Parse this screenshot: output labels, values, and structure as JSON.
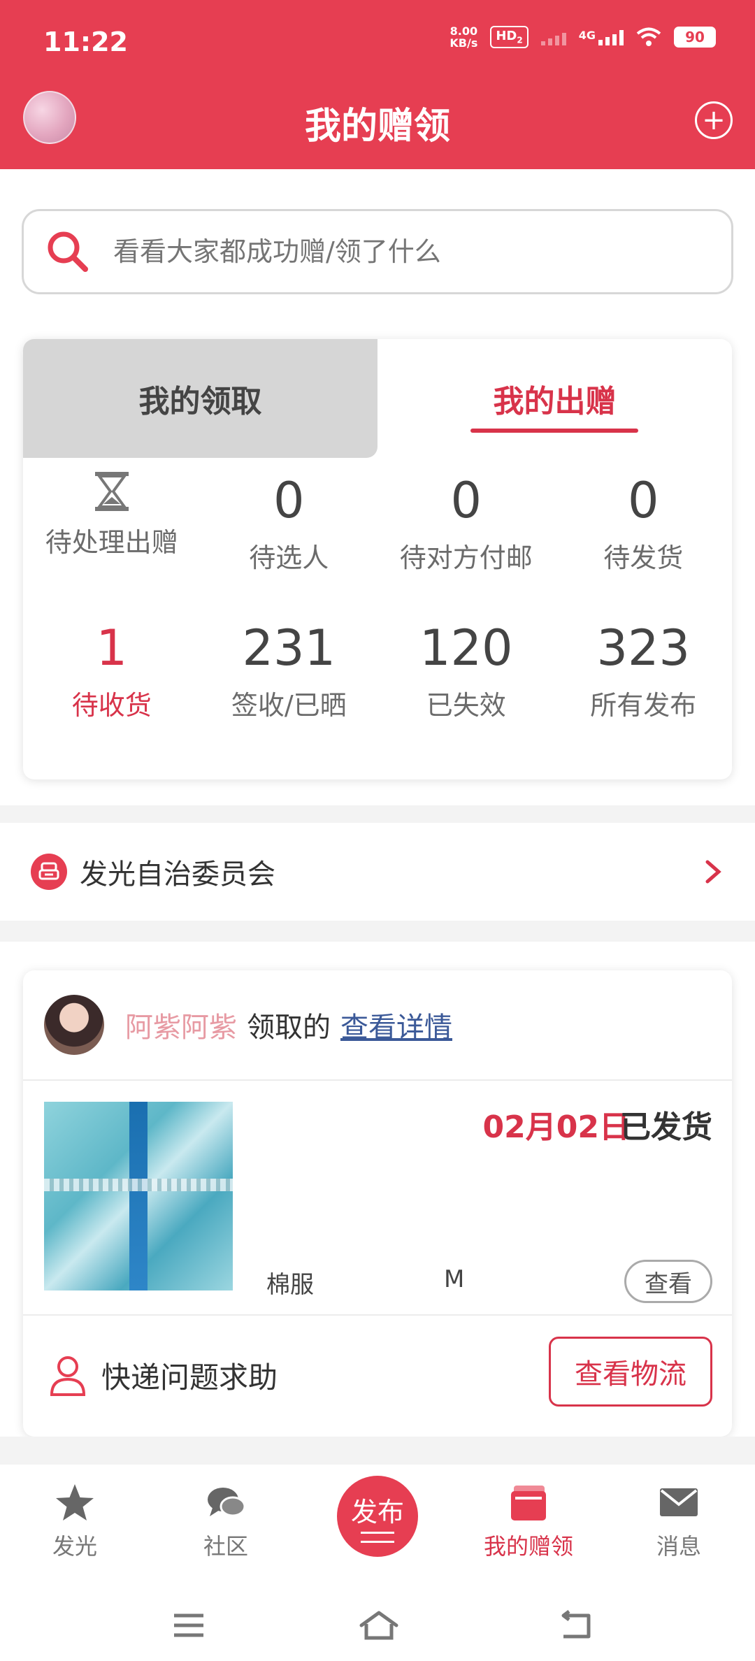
{
  "status_bar": {
    "time": "11:22",
    "net_speed_value": "8.00",
    "net_speed_unit": "KB/s",
    "hd_label": "HD",
    "hd_sub": "2",
    "network": "4G",
    "battery": "90"
  },
  "header": {
    "title": "我的赠领"
  },
  "search": {
    "placeholder": "看看大家都成功赠/领了什么"
  },
  "tabs": [
    {
      "label": "我的领取",
      "active": false
    },
    {
      "label": "我的出赠",
      "active": true
    }
  ],
  "stats_row1": [
    {
      "value": "",
      "label": "待处理出赠"
    },
    {
      "value": "0",
      "label": "待选人"
    },
    {
      "value": "0",
      "label": "待对方付邮"
    },
    {
      "value": "0",
      "label": "待发货"
    }
  ],
  "stats_row2": [
    {
      "value": "1",
      "label": "待收货"
    },
    {
      "value": "231",
      "label": "签收/已晒"
    },
    {
      "value": "120",
      "label": "已失效"
    },
    {
      "value": "323",
      "label": "所有发布"
    }
  ],
  "committee": {
    "label": "发光自治委员会"
  },
  "item": {
    "user_name": "阿紫阿紫",
    "action": "领取的",
    "detail_link": "查看详情",
    "date": "02月02日",
    "status": "已发货",
    "category": "棉服",
    "size": "M",
    "view_label": "查看",
    "help_label": "快递问题求助",
    "logistics_label": "查看物流"
  },
  "bottom_nav": [
    {
      "label": "发光",
      "icon": "star-icon",
      "active": false
    },
    {
      "label": "社区",
      "icon": "chat-bubbles-icon",
      "active": false
    },
    {
      "label": "发布",
      "icon": "publish-icon",
      "active": false
    },
    {
      "label": "我的赠领",
      "icon": "wallet-icon",
      "active": true
    },
    {
      "label": "消息",
      "icon": "mail-icon",
      "active": false
    }
  ],
  "colors": {
    "brand": "#e63e52",
    "accent_text": "#d8334a",
    "link": "#3b5998",
    "username": "#e79aa3"
  }
}
